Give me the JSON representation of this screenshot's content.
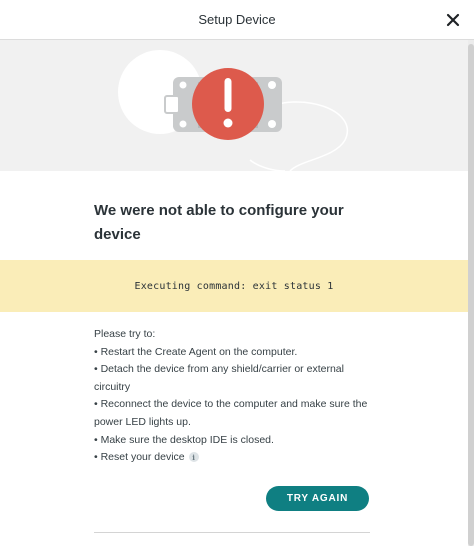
{
  "header": {
    "title": "Setup Device",
    "close_icon": "close-icon"
  },
  "illustration": {
    "icons": [
      "board-icon",
      "error-icon"
    ],
    "colors": {
      "badge": "#dd5a4c",
      "board": "#c9cbcc",
      "background": "#f1f1f1"
    }
  },
  "message": {
    "heading": "We were not able to configure your device"
  },
  "banner": {
    "text": "Executing command: exit status 1",
    "color": "#faedb8"
  },
  "tips": {
    "intro": "Please try to:",
    "items": [
      "• Restart the Create Agent on the computer.",
      "• Detach the device from any shield/carrier or external circuitry",
      "• Reconnect the device to the computer and make sure the power LED lights up.",
      "• Make sure the desktop IDE is closed.",
      "• Reset your device"
    ],
    "info_icon": "i"
  },
  "actions": {
    "try_again": "TRY AGAIN",
    "accent": "#0f7f82"
  }
}
